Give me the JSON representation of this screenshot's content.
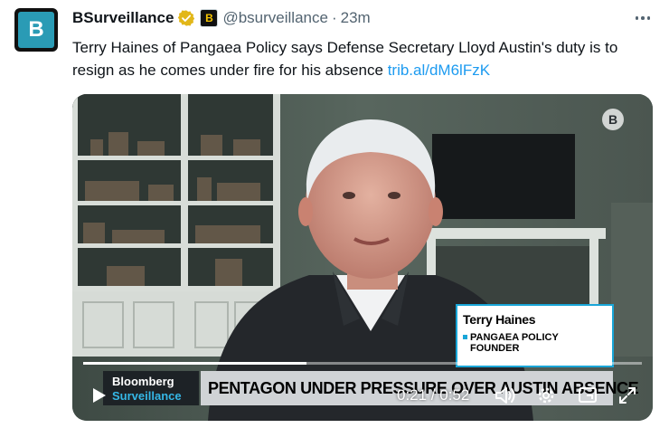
{
  "account": {
    "avatar_letter": "B",
    "display_name": "BSurveillance",
    "affiliate_badge": "B",
    "handle": "@bsurveillance",
    "separator": "·",
    "time": "23m"
  },
  "tweet": {
    "text": "Terry Haines of Pangaea Policy says Defense Secretary Lloyd Austin's duty is to resign as he comes under fire for his absence ",
    "link": "trib.al/dM6lFzK"
  },
  "video": {
    "watermark": "B",
    "lower_third": {
      "name": "Terry Haines",
      "title_line1": "PANGAEA POLICY",
      "title_line2": "FOUNDER"
    },
    "show_brand": {
      "line1": "Bloomberg",
      "line2": "Surveillance"
    },
    "chyron": "PENTAGON UNDER PRESSURE OVER AUSTIN ABSENCE",
    "current_time": "0:21",
    "duration": "0:52",
    "timecode": "0:21 / 0:52",
    "progress_fraction": 0.4
  },
  "icons": {
    "verified": "verified-badge-icon",
    "more": "more-icon",
    "play": "play-icon",
    "volume": "volume-icon",
    "settings": "settings-icon",
    "pip": "pip-icon",
    "fullscreen": "fullscreen-icon"
  },
  "colors": {
    "link": "#1d9bf0",
    "verified_gold": "#e2b719",
    "secondary_text": "#536471",
    "bloomberg_blue": "#19a6d8"
  }
}
